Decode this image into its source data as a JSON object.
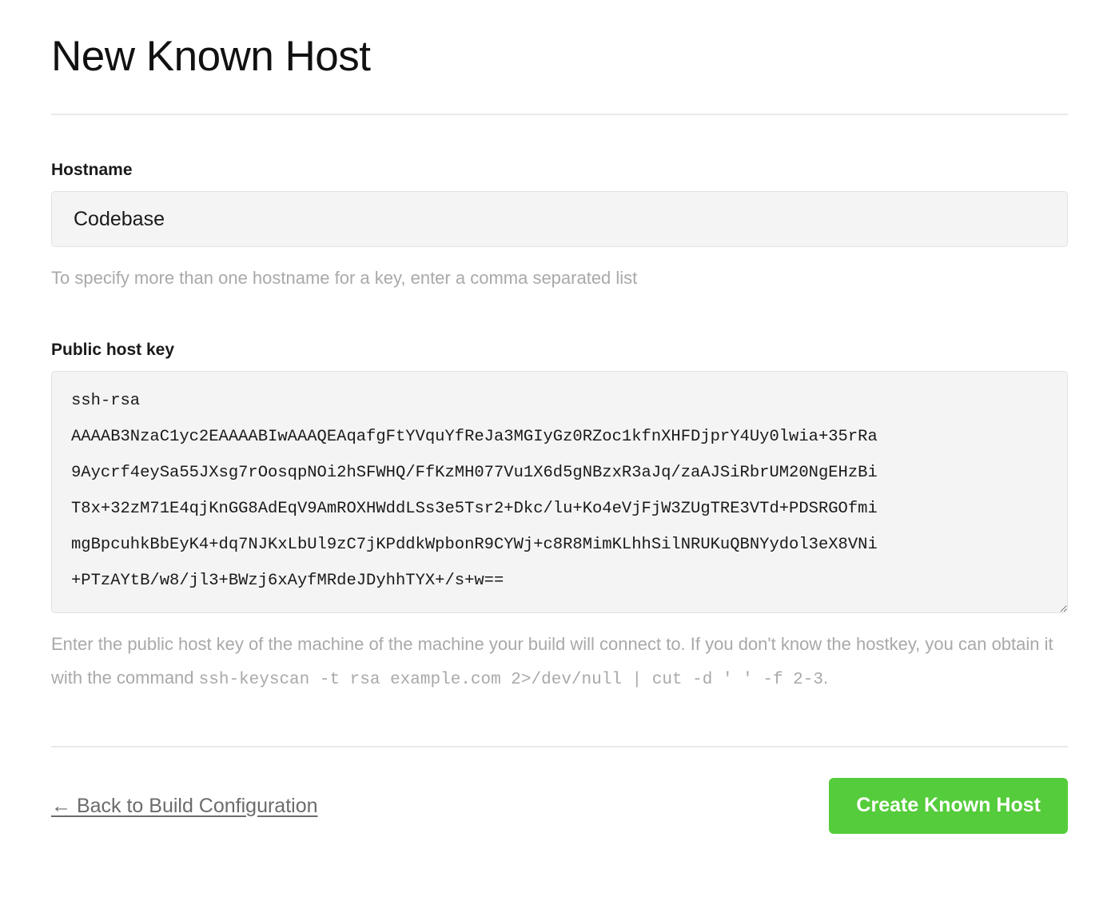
{
  "page": {
    "title": "New Known Host"
  },
  "hostname_field": {
    "label": "Hostname",
    "value": "Codebase",
    "placeholder": "",
    "help": "To specify more than one hostname for a key, enter a comma separated list"
  },
  "public_host_key_field": {
    "label": "Public host key",
    "value": "ssh-rsa\nAAAAB3NzaC1yc2EAAAABIwAAAQEAqafgFtYVquYfReJa3MGIyGz0RZoc1kfnXHFDjprY4Uy0lwia+35rRa\n9Aycrf4eySa55JXsg7rOosqpNOi2hSFWHQ/FfKzMH077Vu1X6d5gNBzxR3aJq/zaAJSiRbrUM20NgEHzBi\nT8x+32zM71E4qjKnGG8AdEqV9AmROXHWddLSs3e5Tsr2+Dkc/lu+Ko4eVjFjW3ZUgTRE3VTd+PDSRGOfmi\nmgBpcuhkBbEyK4+dq7NJKxLbUl9zC7jKPddkWpbonR9CYWj+c8R8MimKLhhSilNRUKuQBNYydol3eX8VNi\n+PTzAYtB/w8/jl3+BWzj6xAyfMRdeJDyhhTYX+/s+w==",
    "placeholder": "",
    "help_part1": "Enter the public host key of the machine of the machine your build will connect to. If you don't know the hostkey, you can obtain it with the command ",
    "help_code": "ssh-keyscan -t rsa example.com 2>/dev/null | cut -d ' ' -f 2-3",
    "help_part2": "."
  },
  "footer": {
    "back_link_label": "← Back to Build Configuration",
    "submit_label": "Create Known Host"
  },
  "colors": {
    "accent_green": "#55cc3b",
    "field_background": "#f4f4f4",
    "field_border": "#e2e2e2",
    "muted_text": "#a9a9a9",
    "rule": "#e9e9e9"
  }
}
